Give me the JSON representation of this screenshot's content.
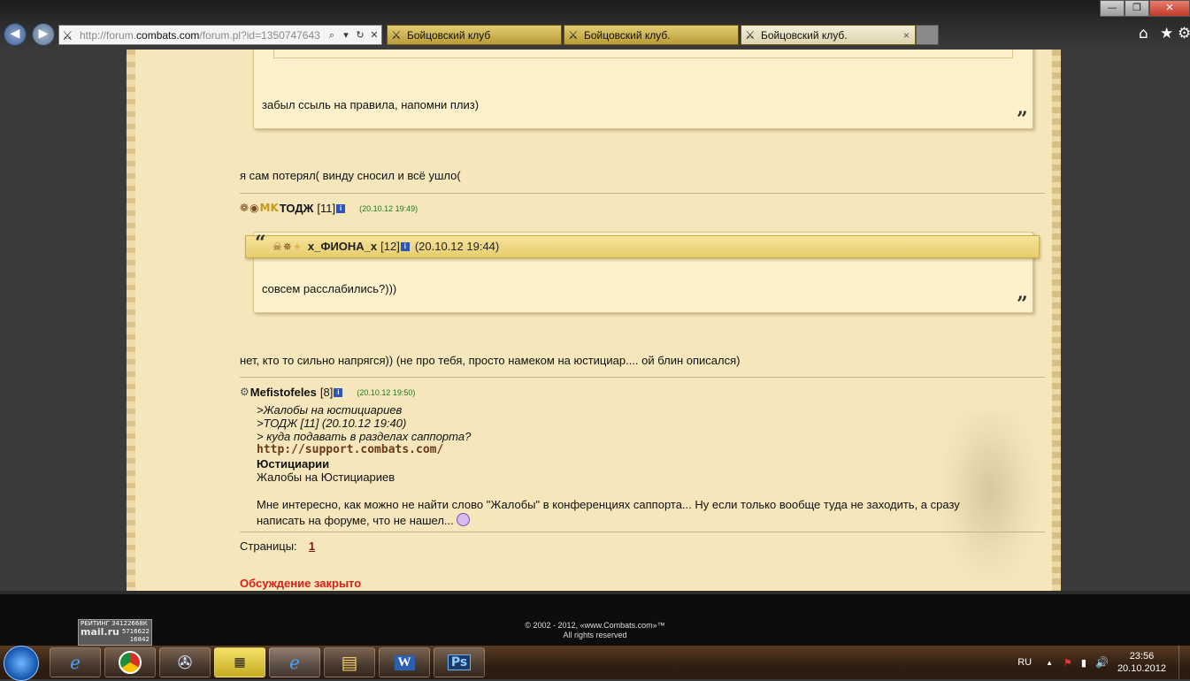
{
  "browser": {
    "url_prefix": "http://forum.",
    "url_domain": "combats.com",
    "url_rest": "/forum.pl?id=1350747643",
    "tabs": [
      {
        "title": "Бойцовский клуб"
      },
      {
        "title": "Бойцовский клуб."
      },
      {
        "title": "Бойцовский клуб."
      }
    ],
    "close_tab_glyph": "×",
    "window_controls": {
      "minimize": "—",
      "maximize": "❐",
      "close": "✕"
    }
  },
  "icons": {
    "favicon": "crossed-swords-icon",
    "home": "home-icon",
    "favorites": "star-icon",
    "tools": "gear-icon"
  },
  "posts": {
    "quote1_text": "забыл ссыль на правила, напомни плиз)",
    "reply1": "я сам потерял( винду сносил и всё ушло(",
    "author1": {
      "name": "ТОДЖ",
      "level": "[11]",
      "date": "(20.10.12 19:49)"
    },
    "quote2_author": {
      "name": "x_ФИОНА_x",
      "level": "[12]",
      "date": "(20.10.12 19:44)"
    },
    "quote2_text": "совсем расслабились?)))",
    "reply2": "нет, кто то сильно напрягся)) (не про тебя, просто намеком на юстициар.... ой блин описался)",
    "author2": {
      "name": "Mefistofeles",
      "level": "[8]",
      "date": "(20.10.12 19:50)"
    },
    "post3": {
      "line1": ">Жалобы на юстициариев",
      "line2": ">ТОДЖ [11] (20.10.12 19:40)",
      "line3": "> куда подавать в разделах саппорта?",
      "link": "http://support.combats.com/",
      "bold": "Юстициарии",
      "plain": "Жалобы на Юстициариев",
      "para1": "Мне интересно, как можно не найти слово \"Жалобы\" в конференциях саппорта... Ну если только вообще туда не заходить, а сразу",
      "para2": "написать на форуме, что не нашел..."
    },
    "pages_label": "Страницы:",
    "pages_current": "1",
    "closed_label": "Обсуждение закрыто"
  },
  "footer": {
    "counter_line1": "РЕЙТИНГ 34122668К",
    "counter_brand": "mail.ru",
    "counter_n1": "5716622",
    "counter_n2": "16842",
    "copyright_line1": "© 2002 - 2012, «www.Combats.com»™",
    "copyright_line2": "All rights reserved"
  },
  "taskbar": {
    "apps": [
      "internet-explorer-icon",
      "chrome-icon",
      "media-player-icon",
      "video-editor-icon",
      "internet-explorer-icon",
      "file-explorer-icon",
      "word-icon",
      "photoshop-icon"
    ],
    "lang": "RU",
    "time": "23:56",
    "date": "20.10.2012",
    "tray_glyphs": {
      "up": "▲",
      "flag": "⚑",
      "network": "▮",
      "volume": "🔊"
    }
  }
}
